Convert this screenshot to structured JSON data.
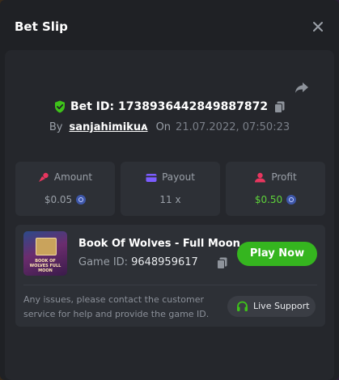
{
  "modal": {
    "title": "Bet Slip"
  },
  "bet": {
    "id_label": "Bet ID: 1738936442849887872",
    "by_label": "By",
    "user": "sanjahimikuᴀ",
    "on_label": "On",
    "datetime": "21.07.2022, 07:50:23"
  },
  "stats": {
    "amount": {
      "label": "Amount",
      "value": "$0.05"
    },
    "payout": {
      "label": "Payout",
      "value": "11 x"
    },
    "profit": {
      "label": "Profit",
      "value": "$0.50"
    }
  },
  "game": {
    "title": "Book Of Wolves - Full Moon",
    "id_label": "Game ID:",
    "id_value": "9648959617",
    "thumb_text": "BOOK OF WOLVES FULL MOON",
    "play_label": "Play Now"
  },
  "help": {
    "text": "Any issues, please contact the customer service for help and provide the game ID.",
    "support_label": "Live Support"
  },
  "colors": {
    "accent_green": "#35b51f",
    "profit_green": "#5ed33a",
    "amount_icon": "#e8365f",
    "payout_icon": "#7b5cff",
    "profit_icon": "#e8365f"
  }
}
